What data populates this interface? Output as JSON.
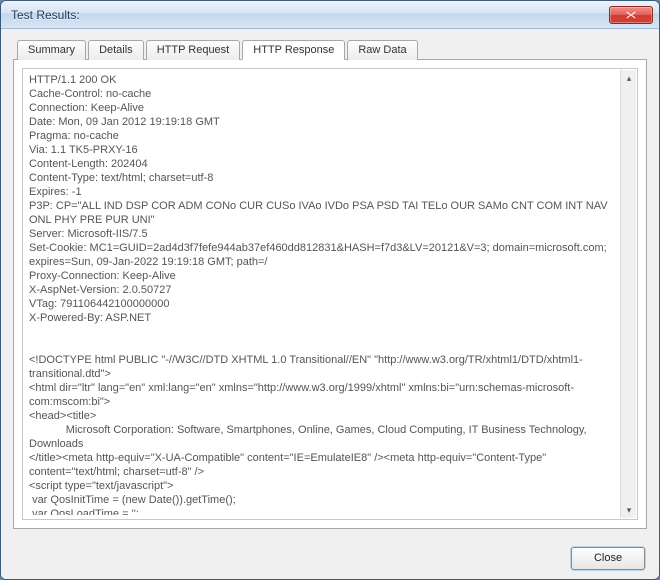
{
  "window": {
    "title": "Test Results:"
  },
  "tabs": {
    "items": [
      {
        "label": "Summary"
      },
      {
        "label": "Details"
      },
      {
        "label": "HTTP Request"
      },
      {
        "label": "HTTP Response"
      },
      {
        "label": "Raw Data"
      }
    ],
    "active_index": 3
  },
  "response_body": "HTTP/1.1 200 OK\nCache-Control: no-cache\nConnection: Keep-Alive\nDate: Mon, 09 Jan 2012 19:19:18 GMT\nPragma: no-cache\nVia: 1.1 TK5-PRXY-16\nContent-Length: 202404\nContent-Type: text/html; charset=utf-8\nExpires: -1\nP3P: CP=\"ALL IND DSP COR ADM CONo CUR CUSo IVAo IVDo PSA PSD TAI TELo OUR SAMo CNT COM INT NAV ONL PHY PRE PUR UNI\"\nServer: Microsoft-IIS/7.5\nSet-Cookie: MC1=GUID=2ad4d3f7fefe944ab37ef460dd812831&HASH=f7d3&LV=20121&V=3; domain=microsoft.com; expires=Sun, 09-Jan-2022 19:19:18 GMT; path=/\nProxy-Connection: Keep-Alive\nX-AspNet-Version: 2.0.50727\nVTag: 791106442100000000\nX-Powered-By: ASP.NET\n\n\n<!DOCTYPE html PUBLIC \"-//W3C//DTD XHTML 1.0 Transitional//EN\" \"http://www.w3.org/TR/xhtml1/DTD/xhtml1-transitional.dtd\">\n<html dir=\"ltr\" lang=\"en\" xml:lang=\"en\" xmlns=\"http://www.w3.org/1999/xhtml\" xmlns:bi=\"urn:schemas-microsoft-com:mscom:bi\">\n<head><title>\n            Microsoft Corporation: Software, Smartphones, Online, Games, Cloud Computing, IT Business Technology, Downloads\n</title><meta http-equiv=\"X-UA-Compatible\" content=\"IE=EmulateIE8\" /><meta http-equiv=\"Content-Type\" content=\"text/html; charset=utf-8\" />\n<script type=\"text/javascript\">\n var QosInitTime = (new Date()).getTime();\n var QosLoadTime = '';\n var QosPageUri = encodeURI(window.location);",
  "footer": {
    "close_label": "Close"
  }
}
